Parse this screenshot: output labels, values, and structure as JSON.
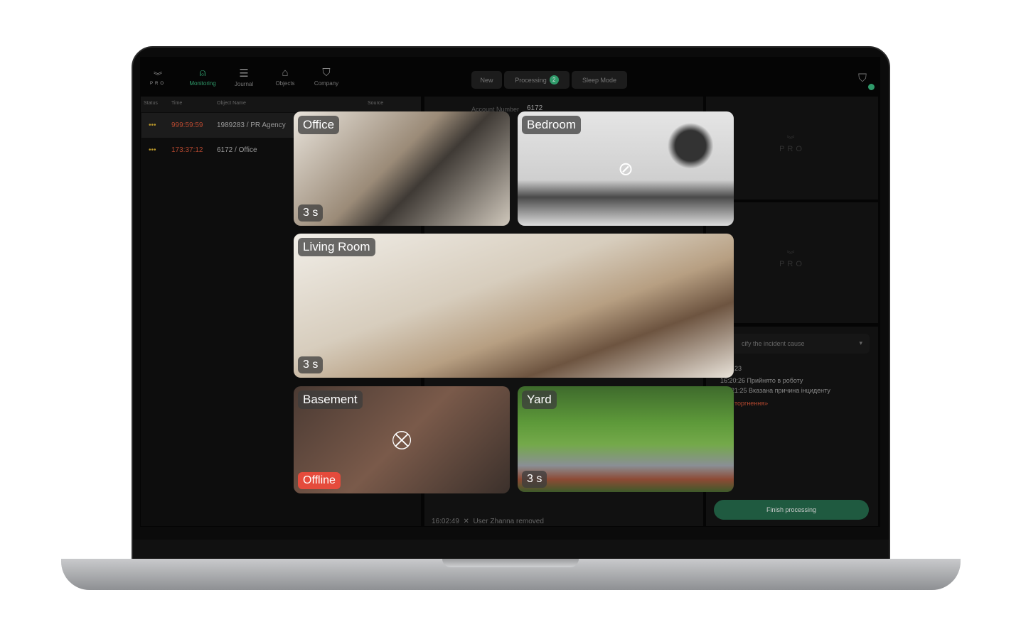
{
  "nav": {
    "brand": "PRO",
    "items": [
      {
        "label": "Monitoring",
        "icon": "alarm-icon",
        "active": true
      },
      {
        "label": "Journal",
        "icon": "journal-icon"
      },
      {
        "label": "Objects",
        "icon": "house-icon"
      },
      {
        "label": "Company",
        "icon": "shield-star-icon"
      }
    ]
  },
  "tabs": [
    {
      "label": "New"
    },
    {
      "label": "Processing",
      "count": "2"
    },
    {
      "label": "Sleep Mode"
    }
  ],
  "table": {
    "headers": [
      "Status",
      "Time",
      "Object Name",
      "Source"
    ],
    "rows": [
      {
        "status": "•••",
        "time": "999:59:59",
        "object": "1989283 / PR Agency"
      },
      {
        "status": "•••",
        "time": "173:37:12",
        "object": "6172 / Office"
      }
    ]
  },
  "details": {
    "account_label": "Account Number",
    "account_value": "6172"
  },
  "incident": {
    "cause_placeholder": "cify the incident cause",
    "log": [
      "23",
      "16:20:26 Прийнято в роботу",
      "21:25 Вказана причина інциденту",
      "торгнення»"
    ],
    "finish": "Finish processing"
  },
  "events": [
    {
      "time": "16:02:49",
      "text": "User Zhanna removed"
    }
  ],
  "cameras": [
    {
      "name": "Office",
      "timer": "3 s"
    },
    {
      "name": "Bedroom",
      "state": "privacy",
      "icon": "eye-off-icon"
    },
    {
      "name": "Living Room",
      "timer": "3 s"
    },
    {
      "name": "Basement",
      "status": "Offline",
      "icon": "camera-off-icon"
    },
    {
      "name": "Yard",
      "timer": "3 s"
    }
  ],
  "colors": {
    "accent": "#2f9a6a",
    "alarm": "#b2472f",
    "offline": "#e54b3c"
  }
}
